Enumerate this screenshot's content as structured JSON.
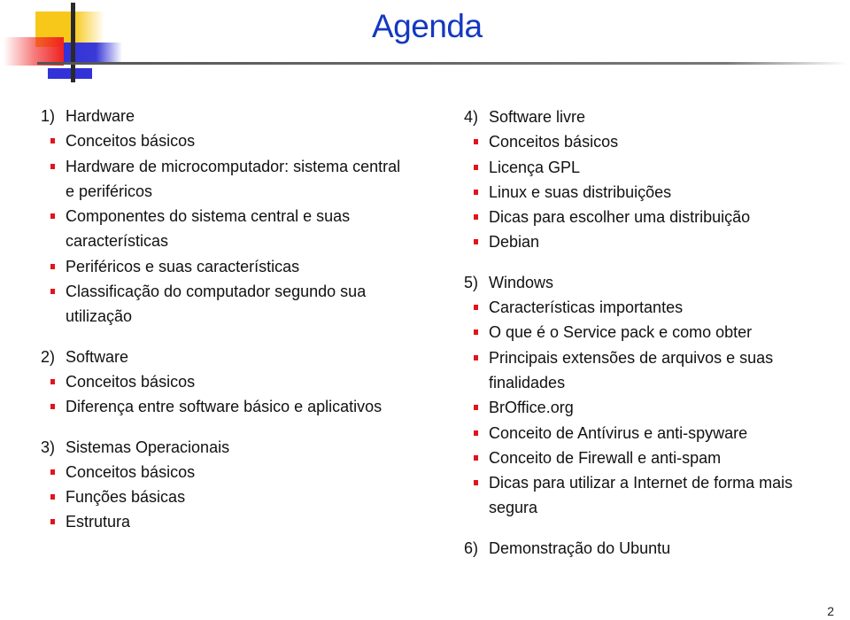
{
  "slide": {
    "title": "Agenda",
    "page_number": "2",
    "colors": {
      "title": "#1438c0",
      "bullet": "#e0141e",
      "text": "#111111"
    },
    "logo_icon": "decorative-squares-logo"
  },
  "left_column": [
    {
      "number": "1)",
      "heading": "Hardware",
      "items": [
        "Conceitos básicos",
        "Hardware de microcomputador: sistema central e periféricos",
        "Componentes do sistema central e suas características",
        "Periféricos e suas características",
        "Classificação do computador segundo sua utilização"
      ]
    },
    {
      "number": "2)",
      "heading": "Software",
      "items": [
        "Conceitos básicos",
        "Diferença entre software básico e aplicativos"
      ]
    },
    {
      "number": "3)",
      "heading": "Sistemas Operacionais",
      "items": [
        "Conceitos básicos",
        "Funções básicas",
        "Estrutura"
      ]
    }
  ],
  "right_column": [
    {
      "number": "4)",
      "heading": "Software livre",
      "items": [
        "Conceitos básicos",
        "Licença GPL",
        "Linux e suas distribuições",
        "Dicas para escolher uma distribuição",
        "Debian"
      ]
    },
    {
      "number": "5)",
      "heading": "Windows",
      "items": [
        "Características importantes",
        "O que é o Service pack e como obter",
        "Principais extensões de arquivos e suas finalidades",
        "BrOffice.org",
        "Conceito de Antívirus e anti-spyware",
        "Conceito de Firewall e anti-spam",
        "Dicas para utilizar a Internet de forma mais segura"
      ]
    },
    {
      "number": "6)",
      "heading": "Demonstração do Ubuntu",
      "items": []
    }
  ]
}
